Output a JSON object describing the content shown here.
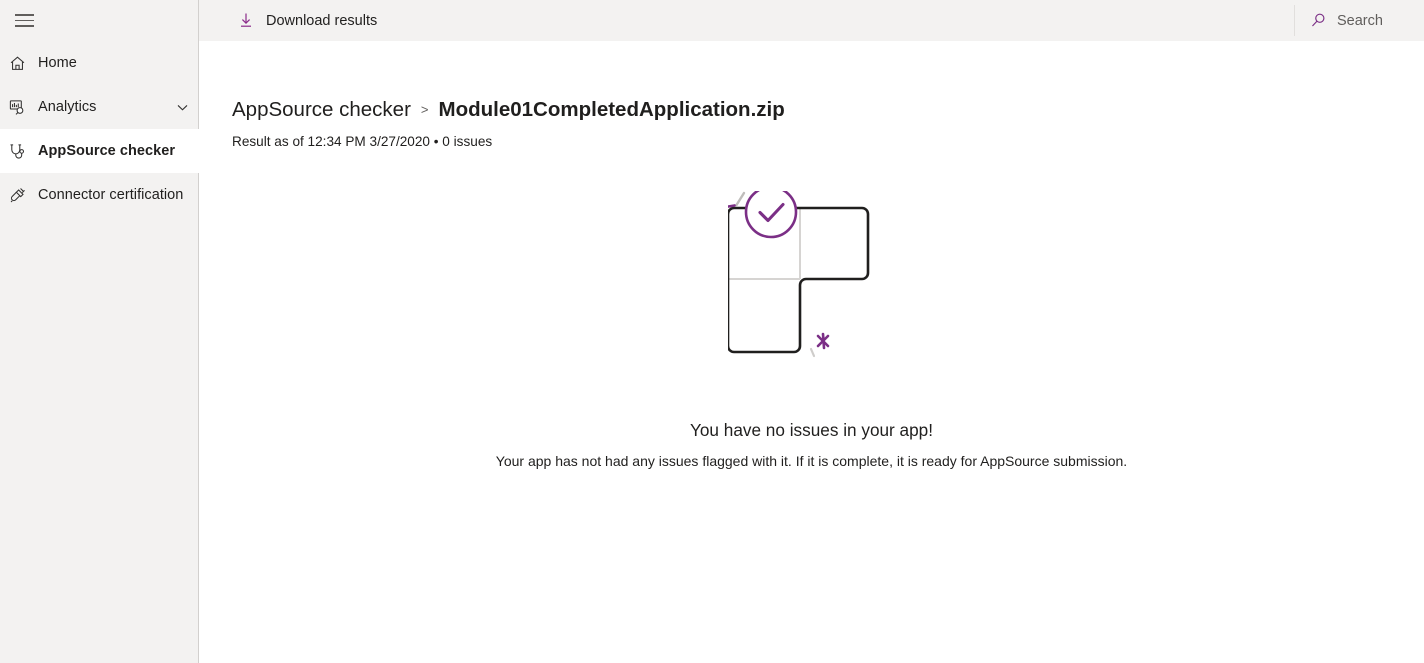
{
  "app": {
    "accent_purple": "#7b2f86",
    "sidebar_bg": "#f3f2f1",
    "selected_bg": "#ffffff",
    "text_color": "#201f1e"
  },
  "sidebar": {
    "menu_button": {
      "name": "hamburger-menu",
      "icon": "hamburger-icon"
    },
    "items": [
      {
        "label": "Home",
        "icon": "home-icon",
        "selected": false,
        "expandable": false
      },
      {
        "label": "Analytics",
        "icon": "analytics-icon",
        "selected": false,
        "expandable": true,
        "chevron": "chevron-down-icon"
      },
      {
        "label": "AppSource checker",
        "icon": "stethoscope-icon",
        "selected": true,
        "expandable": false
      },
      {
        "label": "Connector certification",
        "icon": "connector-icon",
        "selected": false,
        "expandable": false
      }
    ]
  },
  "topbar": {
    "download": {
      "label": "Download results",
      "icon": "download-icon"
    },
    "search": {
      "placeholder": "Search",
      "value": "Search",
      "icon": "search-icon"
    }
  },
  "main": {
    "breadcrumb": {
      "root": "AppSource checker",
      "separator": ">",
      "current": "Module01CompletedApplication.zip"
    },
    "subtitle": "Result as of 12:34 PM 3/27/2020 • 0 issues",
    "result_meta": {
      "timestamp": "12:34 PM 3/27/2020",
      "issue_count": "0 issues"
    },
    "empty_state": {
      "illustration": "checkmark-blocks-illustration",
      "title": "You have no issues in your app!",
      "description": "Your app has not had any issues flagged with it. If it is complete, it is ready for AppSource submission."
    }
  }
}
